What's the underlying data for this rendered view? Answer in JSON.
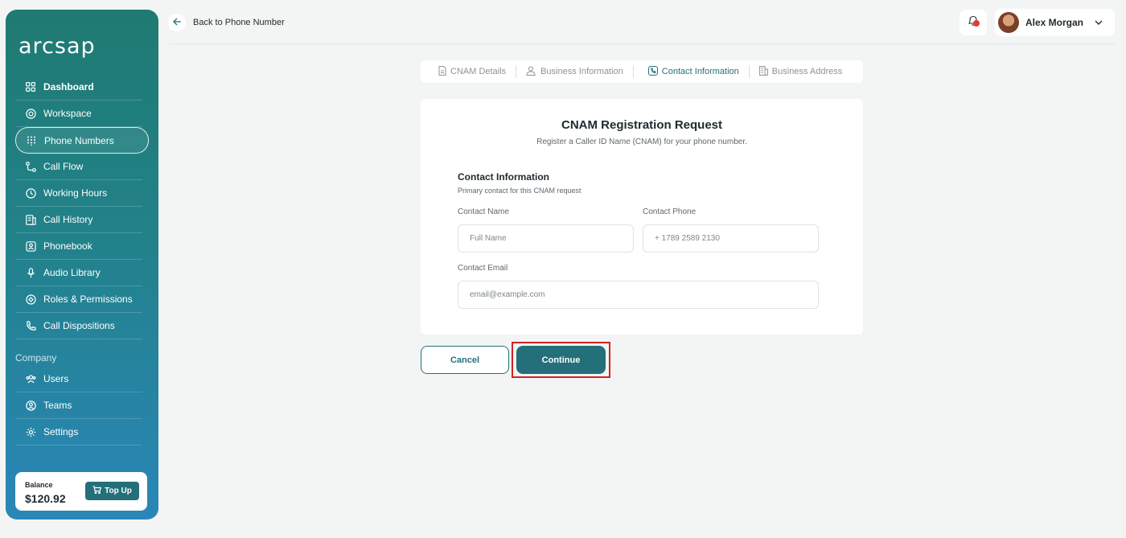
{
  "brand": {
    "logo": "arcsap"
  },
  "sidebar": {
    "items": [
      {
        "label": "Dashboard",
        "icon": "grid-icon"
      },
      {
        "label": "Workspace",
        "icon": "lifebuoy-icon"
      },
      {
        "label": "Phone Numbers",
        "icon": "dialpad-icon"
      },
      {
        "label": "Call Flow",
        "icon": "flow-icon"
      },
      {
        "label": "Working Hours",
        "icon": "clock-icon"
      },
      {
        "label": "Call History",
        "icon": "history-icon"
      },
      {
        "label": "Phonebook",
        "icon": "contact-book-icon"
      },
      {
        "label": "Audio Library",
        "icon": "microphone-icon"
      },
      {
        "label": "Roles & Permissions",
        "icon": "shield-icon"
      },
      {
        "label": "Call Dispositions",
        "icon": "phone-icon"
      }
    ],
    "company_label": "Company",
    "company_items": [
      {
        "label": "Users",
        "icon": "users-icon"
      },
      {
        "label": "Teams",
        "icon": "team-icon"
      },
      {
        "label": "Settings",
        "icon": "gear-icon"
      }
    ],
    "balance": {
      "label": "Balance",
      "value": "$120.92",
      "topup_label": "Top Up"
    }
  },
  "header": {
    "back_label": "Back to Phone Number",
    "user_name": "Alex Morgan"
  },
  "stepper": [
    {
      "label": "CNAM Details",
      "icon": "document-icon",
      "active": false
    },
    {
      "label": "Business Information",
      "icon": "business-icon",
      "active": false
    },
    {
      "label": "Contact Information",
      "icon": "phone-icon",
      "active": true
    },
    {
      "label": "Business Address",
      "icon": "building-icon",
      "active": false
    }
  ],
  "form": {
    "title": "CNAM Registration Request",
    "subtitle": "Register a Caller ID Name (CNAM) for your phone number.",
    "section_title": "Contact Information",
    "section_subtitle": "Primary contact for this CNAM request",
    "contact_name_label": "Contact Name",
    "contact_name_placeholder": "Full Name",
    "contact_name_value": "",
    "contact_phone_label": "Contact Phone",
    "contact_phone_placeholder": "+ 1789 2589 2130",
    "contact_phone_value": "",
    "contact_email_label": "Contact Email",
    "contact_email_placeholder": "email@example.com",
    "contact_email_value": ""
  },
  "actions": {
    "cancel_label": "Cancel",
    "continue_label": "Continue"
  },
  "colors": {
    "accent": "#23707a",
    "highlight": "#d32222",
    "notification": "#e53935"
  }
}
